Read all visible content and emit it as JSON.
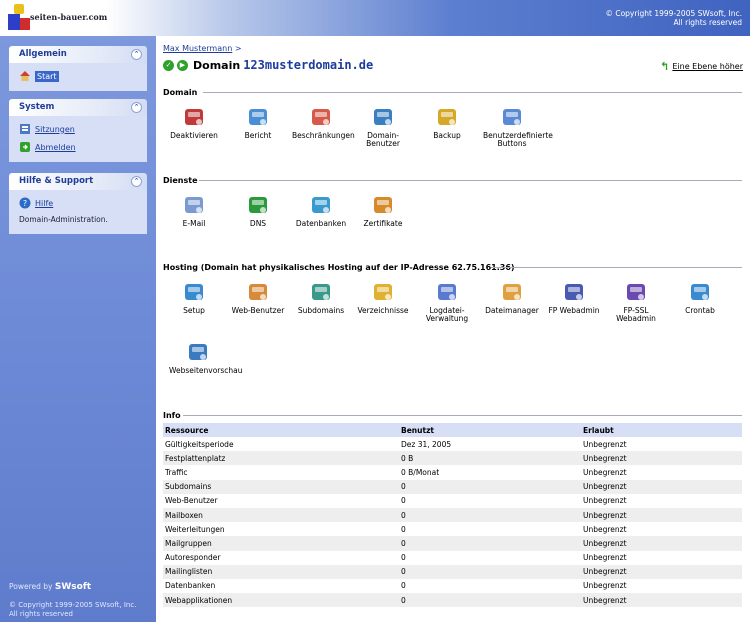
{
  "header": {
    "logo_text": "seiten-bauer.com",
    "copyright_line1": "© Copyright 1999-2005 SWsoft, Inc.",
    "copyright_line2": "All rights reserved"
  },
  "sidebar": {
    "panels": [
      {
        "title": "Allgemein",
        "items": [
          {
            "label": "Start",
            "icon": "home-icon"
          }
        ]
      },
      {
        "title": "System",
        "items": [
          {
            "label": "Sitzungen",
            "icon": "sessions-icon"
          },
          {
            "label": "Abmelden",
            "icon": "logout-icon"
          }
        ]
      },
      {
        "title": "Hilfe & Support",
        "items": [
          {
            "label": "Hilfe",
            "icon": "help-icon"
          }
        ],
        "description": "Domain-Administration."
      }
    ],
    "collapse_symbol": "⌃",
    "powered_by": "Powered by",
    "powered_brand": "SWsoft",
    "copyright_line1": "© Copyright 1999-2005 SWsoft, Inc.",
    "copyright_line2": "All rights reserved"
  },
  "main": {
    "breadcrumb": "Max Mustermann",
    "breadcrumb_sep": ">",
    "title_label": "Domain",
    "title_domain": "123musterdomain.de",
    "up_label": "Eine Ebene höher",
    "sections": {
      "domain": {
        "title": "Domain",
        "buttons": [
          {
            "label": "Deaktivieren",
            "icon": "deactivate-icon",
            "color": "#c03a3a"
          },
          {
            "label": "Bericht",
            "icon": "report-icon",
            "color": "#4a8fd6"
          },
          {
            "label": "Beschränkungen",
            "icon": "limits-icon",
            "color": "#d65a4a"
          },
          {
            "label": "Domain-Benutzer",
            "icon": "domain-user-icon",
            "color": "#3a7fc0"
          },
          {
            "label": "Backup",
            "icon": "backup-icon",
            "color": "#d6a82a"
          },
          {
            "label": "Benutzerdefinierte Buttons",
            "icon": "custom-buttons-icon",
            "color": "#5a8ad6"
          }
        ]
      },
      "services": {
        "title": "Dienste",
        "buttons": [
          {
            "label": "E-Mail",
            "icon": "email-icon",
            "color": "#7a9ad0"
          },
          {
            "label": "DNS",
            "icon": "dns-icon",
            "color": "#2a9a3a"
          },
          {
            "label": "Datenbanken",
            "icon": "database-icon",
            "color": "#3a9ad0"
          },
          {
            "label": "Zertifikate",
            "icon": "certificate-icon",
            "color": "#d68a2a"
          }
        ]
      },
      "hosting": {
        "title": "Hosting (Domain hat physikalisches Hosting auf der IP-Adresse 62.75.161.36)",
        "buttons": [
          {
            "label": "Setup",
            "icon": "setup-icon",
            "color": "#3a8ad0"
          },
          {
            "label": "Web-Benutzer",
            "icon": "web-user-icon",
            "color": "#d68a3a"
          },
          {
            "label": "Subdomains",
            "icon": "subdomains-icon",
            "color": "#3a9a8a"
          },
          {
            "label": "Verzeichnisse",
            "icon": "folders-icon",
            "color": "#e0b030"
          },
          {
            "label": "Logdatei-Verwaltung",
            "icon": "log-icon",
            "color": "#5a7ad0"
          },
          {
            "label": "Dateimanager",
            "icon": "file-manager-icon",
            "color": "#e0a040"
          },
          {
            "label": "FP Webadmin",
            "icon": "fp-webadmin-icon",
            "color": "#4a5ab0"
          },
          {
            "label": "FP-SSL Webadmin",
            "icon": "fp-ssl-webadmin-icon",
            "color": "#6a4ab0"
          },
          {
            "label": "Crontab",
            "icon": "clock-icon",
            "color": "#3a8ad0"
          },
          {
            "label": "Webseitenvorschau",
            "icon": "preview-icon",
            "color": "#3a7ac0"
          }
        ]
      },
      "info": {
        "title": "Info",
        "columns": [
          "Ressource",
          "Benutzt",
          "Erlaubt"
        ],
        "rows": [
          [
            "Gültigkeitsperiode",
            "Dez 31, 2005",
            "Unbegrenzt"
          ],
          [
            "Festplattenplatz",
            "0 B",
            "Unbegrenzt"
          ],
          [
            "Traffic",
            "0 B/Monat",
            "Unbegrenzt"
          ],
          [
            "Subdomains",
            "0",
            "Unbegrenzt"
          ],
          [
            "Web-Benutzer",
            "0",
            "Unbegrenzt"
          ],
          [
            "Mailboxen",
            "0",
            "Unbegrenzt"
          ],
          [
            "Weiterleitungen",
            "0",
            "Unbegrenzt"
          ],
          [
            "Mailgruppen",
            "0",
            "Unbegrenzt"
          ],
          [
            "Autoresponder",
            "0",
            "Unbegrenzt"
          ],
          [
            "Mailinglisten",
            "0",
            "Unbegrenzt"
          ],
          [
            "Datenbanken",
            "0",
            "Unbegrenzt"
          ],
          [
            "Webapplikationen",
            "0",
            "Unbegrenzt"
          ]
        ]
      }
    }
  }
}
